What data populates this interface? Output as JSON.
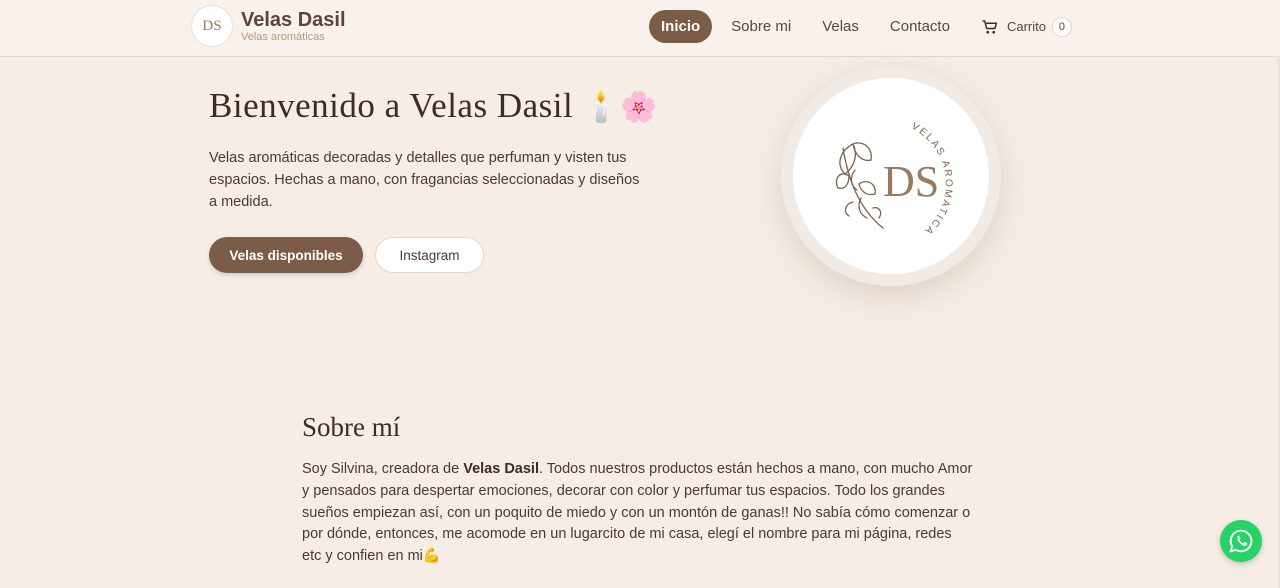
{
  "brand": {
    "logo_text": "DS",
    "name": "Velas Dasil",
    "tagline": "Velas aromáticas"
  },
  "nav": {
    "items": [
      {
        "label": "Inicio",
        "active": true
      },
      {
        "label": "Sobre mi",
        "active": false
      },
      {
        "label": "Velas",
        "active": false
      },
      {
        "label": "Contacto",
        "active": false
      }
    ],
    "cart": {
      "label": "Carrito",
      "count": "0",
      "icon": "cart-icon"
    }
  },
  "hero": {
    "title": "Bienvenido a Velas Dasil",
    "title_emoji": "🕯️🌸",
    "text": "Velas aromáticas decoradas y detalles que perfuman y visten tus espacios. Hechas a mano, con fragancias seleccionadas y diseños a medida.",
    "primary_button": "Velas disponibles",
    "secondary_button": "Instagram",
    "logo": {
      "monogram": "DS",
      "arc_text": "VELAS AROMATICAS"
    }
  },
  "about": {
    "title": "Sobre mí",
    "text_before": "Soy Silvina, creadora de ",
    "text_bold": "Velas Dasil",
    "text_after": ". Todos nuestros productos están hechos a mano, con mucho Amor y pensados para despertar emociones, decorar con color y perfumar tus espacios. Todo los grandes sueños empiezan así, con un poquito de miedo y con un montón de ganas!! No sabía cómo comenzar o por dónde, entonces, me acomode en un lugarcito de mi casa, elegí el nombre para mi página, redes etc y confien en mi💪"
  },
  "colors": {
    "background": "#f5ede6",
    "accent": "#7a5c49",
    "whatsapp": "#25d366"
  },
  "floating": {
    "icon": "whatsapp-icon"
  }
}
